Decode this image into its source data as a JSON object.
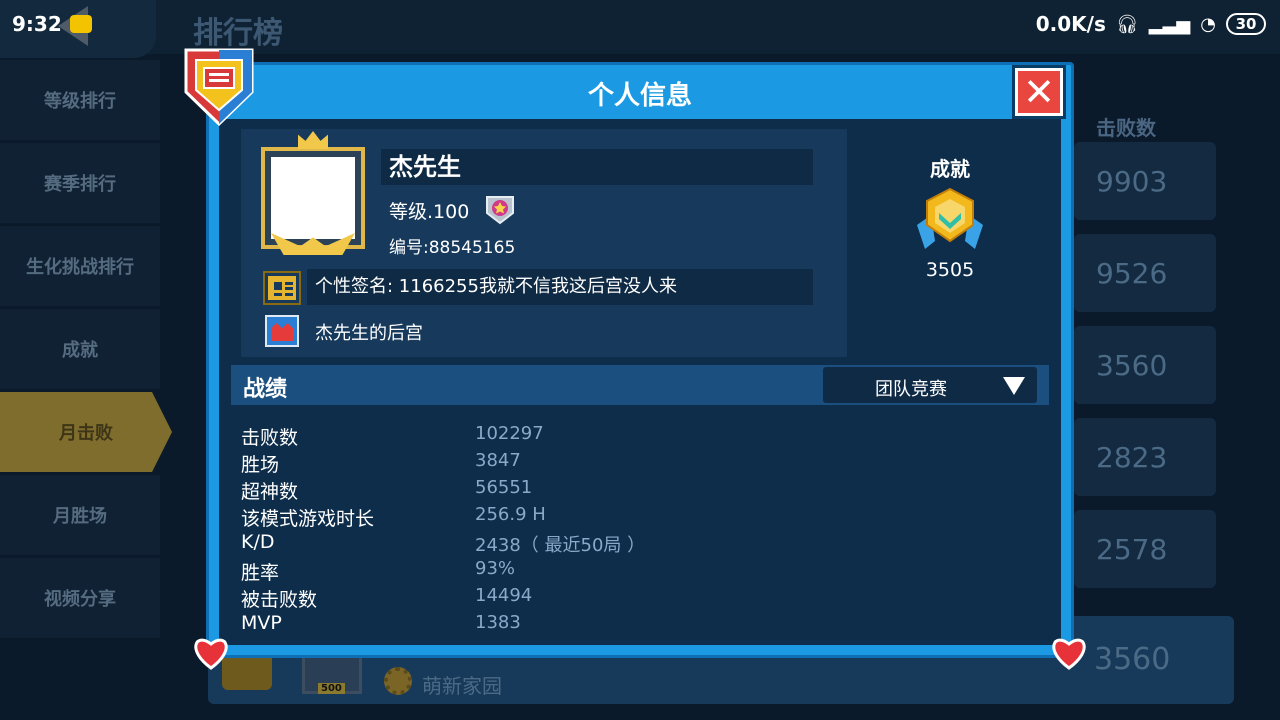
{
  "status_bar": {
    "time": "9:32",
    "net_speed": "0.0K/s",
    "battery": "30"
  },
  "screen": {
    "title": "排行榜",
    "sidebar": [
      {
        "label": "等级排行",
        "active": false
      },
      {
        "label": "赛季排行",
        "active": false
      },
      {
        "label": "生化挑战排行",
        "active": false
      },
      {
        "label": "成就",
        "active": false
      },
      {
        "label": "月击败",
        "active": true
      },
      {
        "label": "月胜场",
        "active": false
      },
      {
        "label": "视频分享",
        "active": false
      }
    ],
    "column_header": "击败数",
    "rows": [
      "9903",
      "9526",
      "3560",
      "2823",
      "2578"
    ],
    "bottom_bar": {
      "avatar_tag": "500",
      "name": "萌新家园",
      "value": "3560"
    }
  },
  "modal": {
    "title": "个人信息",
    "close_icon": "close-icon",
    "player": {
      "name": "杰先生",
      "level": "等级.100",
      "id": "编号:88545165",
      "signature": "个性签名: 1166255我就不信我这后宫没人来",
      "guild": "杰先生的后宫"
    },
    "achievement": {
      "label": "成就",
      "value": "3505"
    },
    "record": {
      "title": "战绩",
      "mode": "团队竞赛",
      "stats": [
        {
          "label": "击败数",
          "value": "102297"
        },
        {
          "label": "胜场",
          "value": "3847"
        },
        {
          "label": "超神数",
          "value": "56551"
        },
        {
          "label": "该模式游戏时长",
          "value": "256.9 H"
        },
        {
          "label": "K/D",
          "value": "2438（ 最近50局 ）"
        },
        {
          "label": "胜率",
          "value": "93%"
        },
        {
          "label": "被击败数",
          "value": "14494"
        },
        {
          "label": "MVP",
          "value": "1383"
        }
      ]
    }
  },
  "colors": {
    "modal_frame": "#1b9ae3",
    "modal_body": "#0d2d4b",
    "close_button": "#e8463e",
    "stat_value": "#8aa9c8",
    "active_tab": "#7f6d2e"
  }
}
